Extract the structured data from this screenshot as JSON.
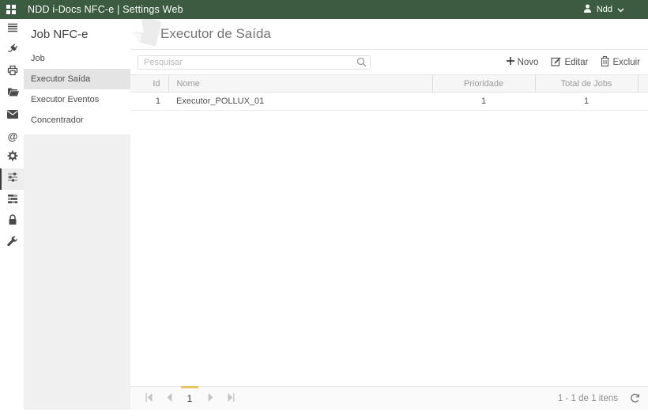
{
  "colors": {
    "header_bg": "#3b5c41",
    "selected_page_indicator": "#eec45e",
    "selected_menu_bg": "#e4e4e4"
  },
  "header": {
    "app_icon": "grid-icon",
    "title": "NDD i-Docs NFC-e | Settings Web",
    "user": {
      "icon": "user-icon",
      "name": "Ndd",
      "chevron": "chevron-down-icon"
    }
  },
  "iconbar": {
    "items": [
      {
        "icon": "menu-icon",
        "selected": false
      },
      {
        "icon": "plug-icon",
        "selected": false
      },
      {
        "icon": "printer-icon",
        "selected": false
      },
      {
        "icon": "folder-icon",
        "selected": false
      },
      {
        "icon": "mail-icon",
        "selected": false
      },
      {
        "icon": "at-icon",
        "selected": false
      },
      {
        "icon": "gear-icon",
        "selected": false
      },
      {
        "icon": "sliders-icon",
        "selected": true
      },
      {
        "icon": "queue-icon",
        "selected": false
      },
      {
        "icon": "lock-icon",
        "selected": false
      },
      {
        "icon": "wrench-icon",
        "selected": false
      }
    ]
  },
  "sidebar": {
    "heading": "Job NFC-e",
    "items": [
      {
        "label": "Job",
        "selected": false
      },
      {
        "label": "Executor Saída",
        "selected": true
      },
      {
        "label": "Executor Eventos",
        "selected": false
      },
      {
        "label": "Concentrador",
        "selected": false
      }
    ]
  },
  "page": {
    "title": "Executor de Saída"
  },
  "toolbar": {
    "search_placeholder": "Pesquisar",
    "search_value": "",
    "buttons": [
      {
        "icon": "plus-icon",
        "label": "Novo"
      },
      {
        "icon": "edit-icon",
        "label": "Editar"
      },
      {
        "icon": "trash-icon",
        "label": "Excluir"
      }
    ]
  },
  "grid": {
    "columns": [
      "Id",
      "Nome",
      "Prioridade",
      "Total de Jobs"
    ],
    "rows": [
      {
        "id": "1",
        "nome": "Executor_POLLUX_01",
        "prioridade": "1",
        "total_de_jobs": "1"
      }
    ]
  },
  "pager": {
    "current_page": "1",
    "info": "1 - 1 de 1 itens",
    "refresh_icon": "refresh-icon"
  }
}
